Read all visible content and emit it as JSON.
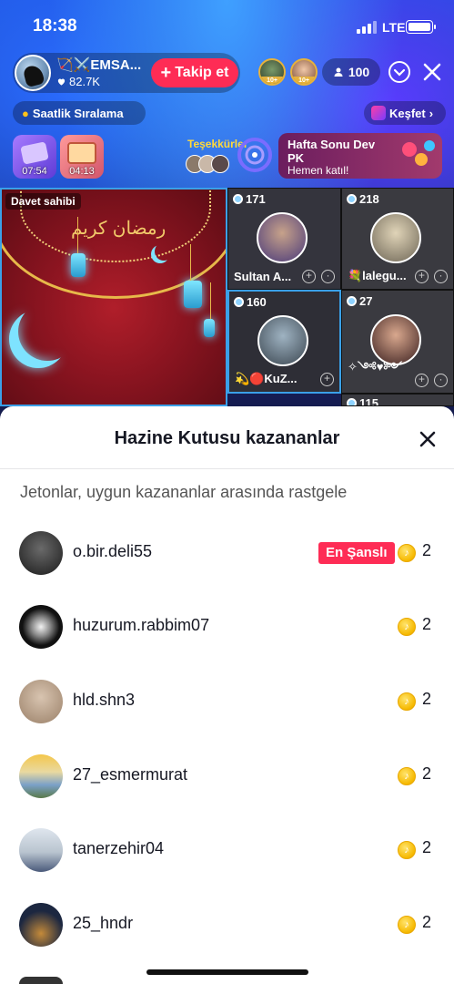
{
  "status_bar": {
    "time": "18:38",
    "network": "LTE"
  },
  "host": {
    "name": "🏹⚔️EMSA...",
    "likes": "82.7K",
    "follow_label": "Takip et"
  },
  "top_viewers": [
    {
      "badge": "10+"
    },
    {
      "badge": "10+"
    }
  ],
  "viewer_count": "100",
  "ranking_label": "Saatlik Sıralama",
  "explore_label": "Keşfet",
  "gift_timers": [
    "07:54",
    "04:13"
  ],
  "thanks_label": "Teşekkürler",
  "pk_banner": {
    "title": "Hafta Sonu Dev PK",
    "subtitle": "Hemen katıl!"
  },
  "host_cell": {
    "tag": "Davet sahibi",
    "calligraphy": "رمضان كريم"
  },
  "guests": [
    {
      "count": "171",
      "name": "Sultan A..."
    },
    {
      "count": "218",
      "name": "💐lalegu..."
    },
    {
      "count": "160",
      "name": "💫🔴KuZ..."
    },
    {
      "count": "27",
      "name": "✧༺♥༻"
    },
    {
      "count": "115",
      "name": ""
    }
  ],
  "sheet": {
    "title": "Hazine Kutusu kazananlar",
    "subtitle": "Jetonlar, uygun kazananlar arasında rastgele",
    "lucky_badge": "En Şanslı",
    "winners": [
      {
        "name": "o.bir.deli55",
        "amount": "2"
      },
      {
        "name": "huzurum.rabbim07",
        "amount": "2"
      },
      {
        "name": "hld.shn3",
        "amount": "2"
      },
      {
        "name": "27_esmermurat",
        "amount": "2"
      },
      {
        "name": "tanerzehir04",
        "amount": "2"
      },
      {
        "name": "25_hndr",
        "amount": "2"
      }
    ]
  },
  "colors": {
    "accent": "#fe2c55",
    "coin": "#f6b900",
    "gold": "#e7b94a"
  }
}
